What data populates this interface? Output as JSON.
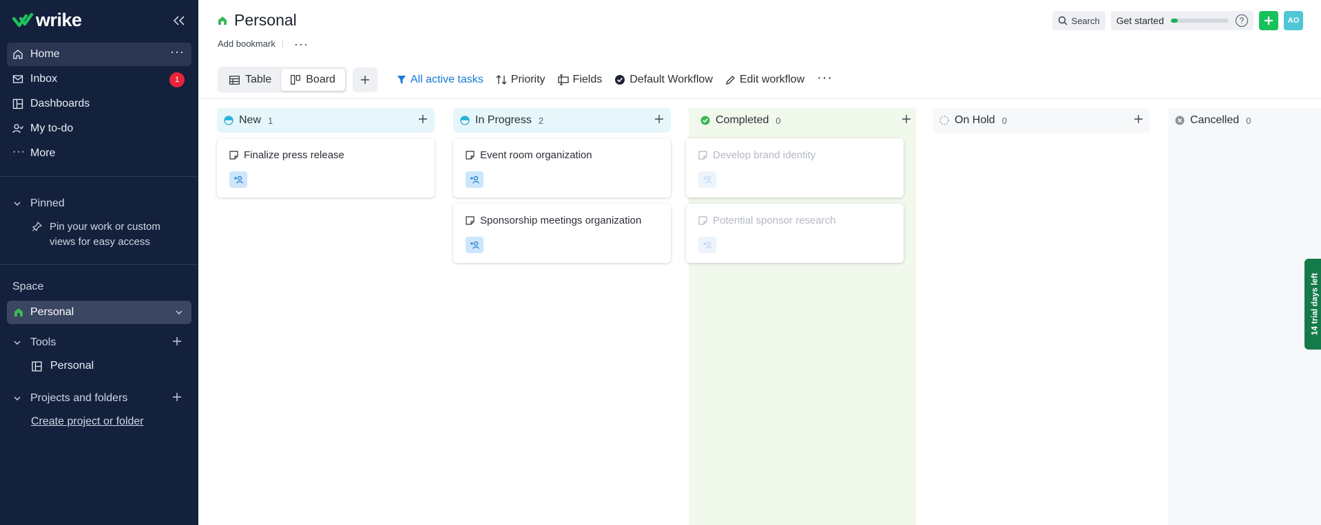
{
  "brand": {
    "name": "wrike",
    "logo_color": "#1fc15c"
  },
  "sidebar": {
    "nav": [
      {
        "label": "Home",
        "icon": "home-icon"
      },
      {
        "label": "Inbox",
        "icon": "inbox-icon",
        "badge": "1"
      },
      {
        "label": "Dashboards",
        "icon": "dashboard-icon"
      },
      {
        "label": "My to-do",
        "icon": "user-task-icon"
      },
      {
        "label": "More",
        "icon": "more-horizontal-icon"
      }
    ],
    "pinned": {
      "label": "Pinned",
      "hint": "Pin your work or custom views for easy access"
    },
    "space": {
      "label": "Space",
      "selected": "Personal"
    },
    "tools": {
      "label": "Tools",
      "items": [
        {
          "label": "Personal"
        }
      ]
    },
    "projects": {
      "label": "Projects and folders",
      "create_link": "Create project or folder"
    }
  },
  "header": {
    "title": "Personal",
    "add_bookmark": "Add bookmark",
    "search": "Search",
    "get_started": "Get started",
    "get_started_progress": 0.12,
    "avatar_initials": "AO"
  },
  "toolbar": {
    "views": [
      {
        "label": "Table"
      },
      {
        "label": "Board",
        "active": true
      }
    ],
    "filter": "All active tasks",
    "priority": "Priority",
    "fields": "Fields",
    "workflow": "Default Workflow",
    "edit_workflow": "Edit workflow"
  },
  "board": {
    "columns": [
      {
        "name": "New",
        "count": "1",
        "color": "#2bb3d9",
        "cards": [
          {
            "title": "Finalize press release"
          }
        ]
      },
      {
        "name": "In Progress",
        "count": "2",
        "color": "#2bb3d9",
        "cards": [
          {
            "title": "Event room organization"
          },
          {
            "title": "Sponsorship meetings organization"
          }
        ]
      },
      {
        "name": "Completed",
        "count": "0",
        "color": "#3cb858",
        "cards": [
          {
            "title": "Develop brand identity"
          },
          {
            "title": "Potential sponsor research"
          }
        ]
      },
      {
        "name": "On Hold",
        "count": "0",
        "color": "#9aa1ad",
        "cards": []
      },
      {
        "name": "Cancelled",
        "count": "0",
        "color": "#8b919c",
        "cards": []
      }
    ]
  },
  "trial": "14 trial days left"
}
